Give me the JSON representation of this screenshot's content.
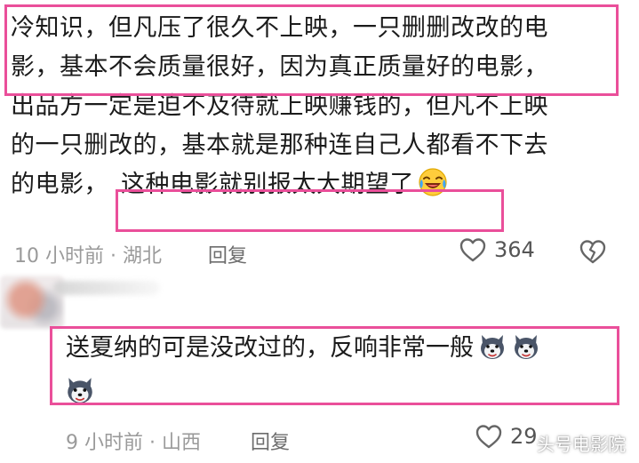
{
  "comment1": {
    "lines": [
      "冷知识，但凡压了很久不上映，一只删删改改的电",
      "影，基本不会质量很好，因为真正质量好的电影，",
      "出品方一定是迫不及待就上映赚钱的，但凡不上映",
      "的一只删改的，基本就是那种连自己人都看不下去",
      "的电影，"
    ],
    "highlight_tail": "这种电影就别报太大期望了",
    "emoji": "laughing-crying-emoji",
    "time_location": "10 小时前 · 湖北",
    "reply_label": "回复",
    "likes": "364",
    "like_icon": "heart-outline-icon",
    "dislike_icon": "broken-heart-icon"
  },
  "comment2": {
    "text": "送夏纳的可是没改过的，反响非常一般",
    "emoji": "husky-dog-emoji",
    "time_location": "9 小时前 · 山西",
    "reply_label": "回复",
    "likes": "29",
    "like_icon": "heart-outline-icon"
  },
  "watermark": "头号电影院",
  "colors": {
    "highlight_border": "#ea4f9a",
    "text": "#1b1b1b",
    "meta": "#9a9a9a"
  }
}
